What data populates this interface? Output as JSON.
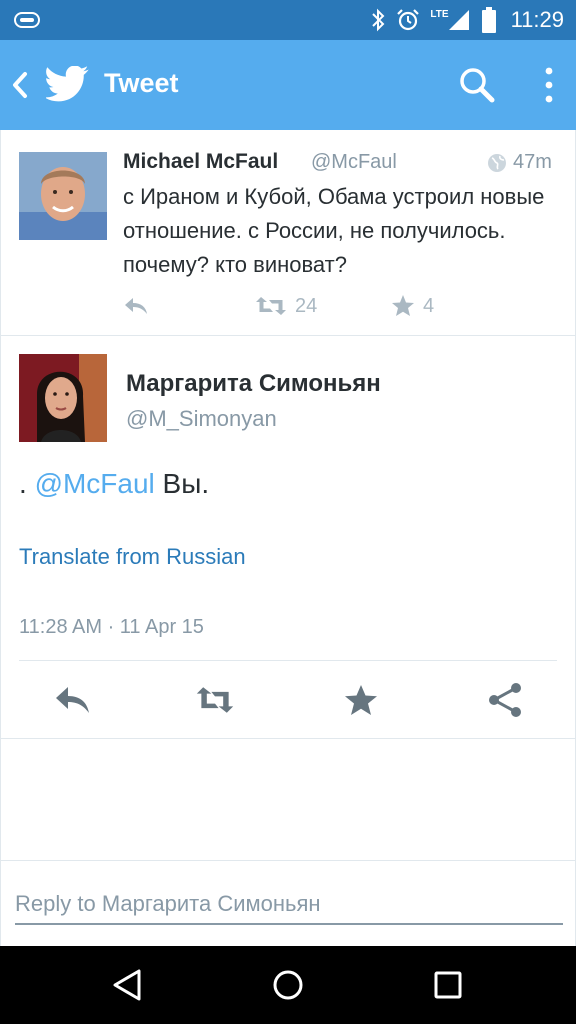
{
  "status_bar": {
    "time": "11:29",
    "network": "LTE"
  },
  "app_bar": {
    "title": "Tweet"
  },
  "tweet": {
    "author_name": "Michael McFaul",
    "author_handle": "@McFaul",
    "age": "47m",
    "text": "с Ираном и Кубой, Обама устроил новые отношение. с России, не получилось. почему? кто виноват?",
    "retweets": "24",
    "favorites": "4"
  },
  "reply": {
    "author_name": "Маргарита Симоньян",
    "author_handle": "@M_Simonyan",
    "text_prefix": ". ",
    "mention": "@McFaul",
    "text_suffix": " Вы.",
    "translate_label": "Translate from Russian",
    "timestamp": "11:28 AM · 11 Apr 15"
  },
  "composer": {
    "placeholder": "Reply to Маргарита Симоньян"
  },
  "colors": {
    "status_bar": "#2a78b8",
    "app_bar": "#55acee",
    "link": "#2b7bb9",
    "muted": "#8899a6",
    "action_icon": "#66757f"
  }
}
